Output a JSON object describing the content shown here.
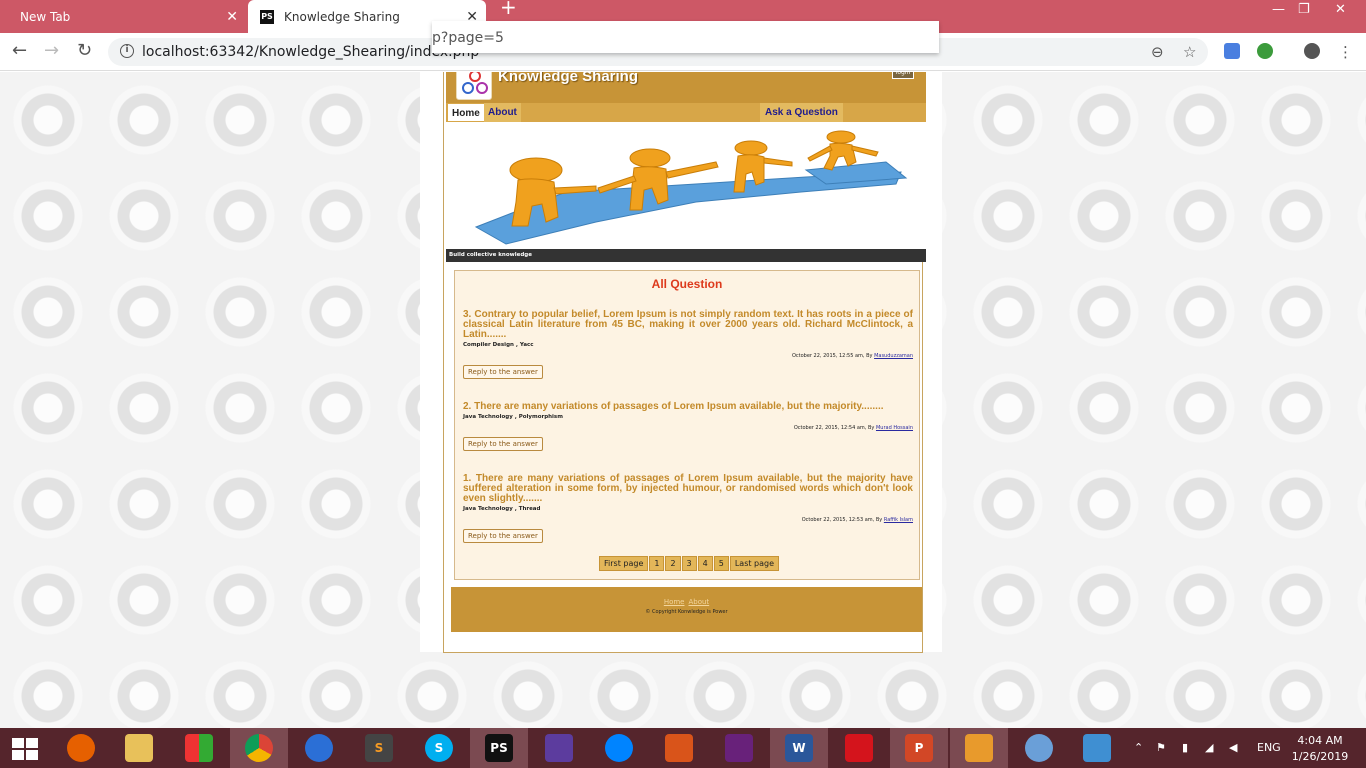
{
  "browser": {
    "tabs": [
      {
        "label": "New Tab",
        "active": false
      },
      {
        "label": "Knowledge Sharing",
        "active": true
      }
    ],
    "url": "localhost:63342/Knowledge_Shearing/index.php",
    "url_suggestion": "p?page=5"
  },
  "site": {
    "title": "Knowledge Sharing",
    "login_label": "login",
    "menu": {
      "home": "Home",
      "about": "About",
      "ask": "Ask a Question"
    },
    "tagline": "Build collective knowledge"
  },
  "content": {
    "heading": "All Question",
    "reply_label": "Reply to the answer",
    "questions": [
      {
        "title": "3. Contrary to popular belief, Lorem Ipsum is not simply random text. It has roots in a piece of classical Latin literature from 45 BC, making it over 2000 years old. Richard McClintock, a Latin.......",
        "tags": "Compiler Design , Yacc",
        "date": "October 22, 2015, 12:55 am, By ",
        "author": "Masuduzzaman"
      },
      {
        "title": "2. There are many variations of passages of Lorem Ipsum available, but the majority........",
        "tags": "Java Technology , Polymorphism",
        "date": "October 22, 2015, 12:54 am, By ",
        "author": "Murad Hossain"
      },
      {
        "title": "1. There are many variations of passages of Lorem Ipsum available, but the majority have suffered alteration in some form, by injected humour, or randomised words which don't look even slightly.......",
        "tags": "Java Technology , Thread",
        "date": "October 22, 2015, 12:53 am, By ",
        "author": "Raffik Islam"
      }
    ],
    "pager": {
      "first": "First page",
      "p1": "1",
      "p2": "2",
      "p3": "3",
      "p4": "4",
      "p5": "5",
      "last": "Last page"
    }
  },
  "footer": {
    "home": "Home",
    "about": "About",
    "copyright": "© Copyright Konwledge is Power"
  },
  "taskbar": {
    "lang": "ENG",
    "time": "4:04 AM",
    "date": "1/26/2019"
  },
  "colors": {
    "header": "#c79437",
    "tabbar": "#cd5866",
    "taskbar": "#55252c",
    "question_title": "#c38a2a",
    "heading": "#dd3a1c"
  }
}
